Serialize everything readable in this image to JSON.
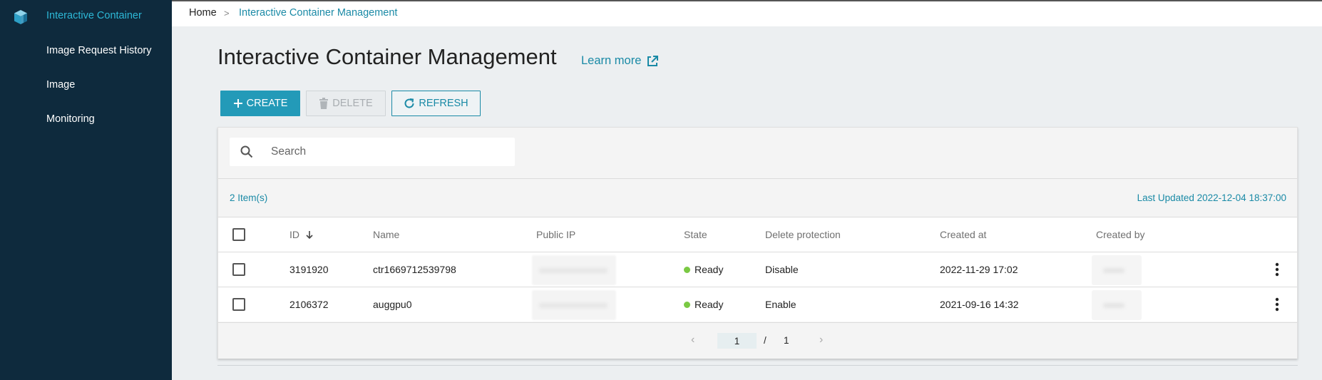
{
  "sidebar": {
    "logo_icon": "cube-icon",
    "items": [
      {
        "label": "Interactive Container",
        "active": true
      },
      {
        "label": "Image Request History",
        "active": false
      },
      {
        "label": "Image",
        "active": false
      },
      {
        "label": "Monitoring",
        "active": false
      }
    ]
  },
  "breadcrumb": {
    "home": "Home",
    "separator": ">",
    "current": "Interactive Container Management"
  },
  "page": {
    "title": "Interactive Container Management",
    "learn_more": "Learn more",
    "learn_more_icon": "external-link-icon"
  },
  "toolbar": {
    "create_label": "CREATE",
    "create_icon": "plus-icon",
    "delete_label": "DELETE",
    "delete_icon": "trash-icon",
    "delete_disabled": true,
    "refresh_label": "REFRESH",
    "refresh_icon": "refresh-icon"
  },
  "search": {
    "placeholder": "Search",
    "value": ""
  },
  "summary": {
    "item_count": "2 Item(s)",
    "last_updated": "Last Updated 2022-12-04 18:37:00"
  },
  "table": {
    "columns": {
      "id": "ID",
      "name": "Name",
      "public_ip": "Public IP",
      "state": "State",
      "delete_protection": "Delete protection",
      "created_at": "Created at",
      "created_by": "Created by"
    },
    "sort_column": "ID",
    "sort_direction": "descending",
    "rows": [
      {
        "id": "3191920",
        "name": "ctr1669712539798",
        "state": "Ready",
        "delete_protection": "Disable",
        "created_at": "2022-11-29 17:02"
      },
      {
        "id": "2106372",
        "name": "auggpu0",
        "state": "Ready",
        "delete_protection": "Enable",
        "created_at": "2021-09-16 14:32"
      }
    ]
  },
  "pagination": {
    "current_page": "1",
    "separator": "/",
    "total_pages": "1"
  },
  "colors": {
    "sidebar_bg": "#0e2a3d",
    "accent": "#1a8aa6",
    "create_button": "#239ab8",
    "status_ready": "#7ac943"
  }
}
